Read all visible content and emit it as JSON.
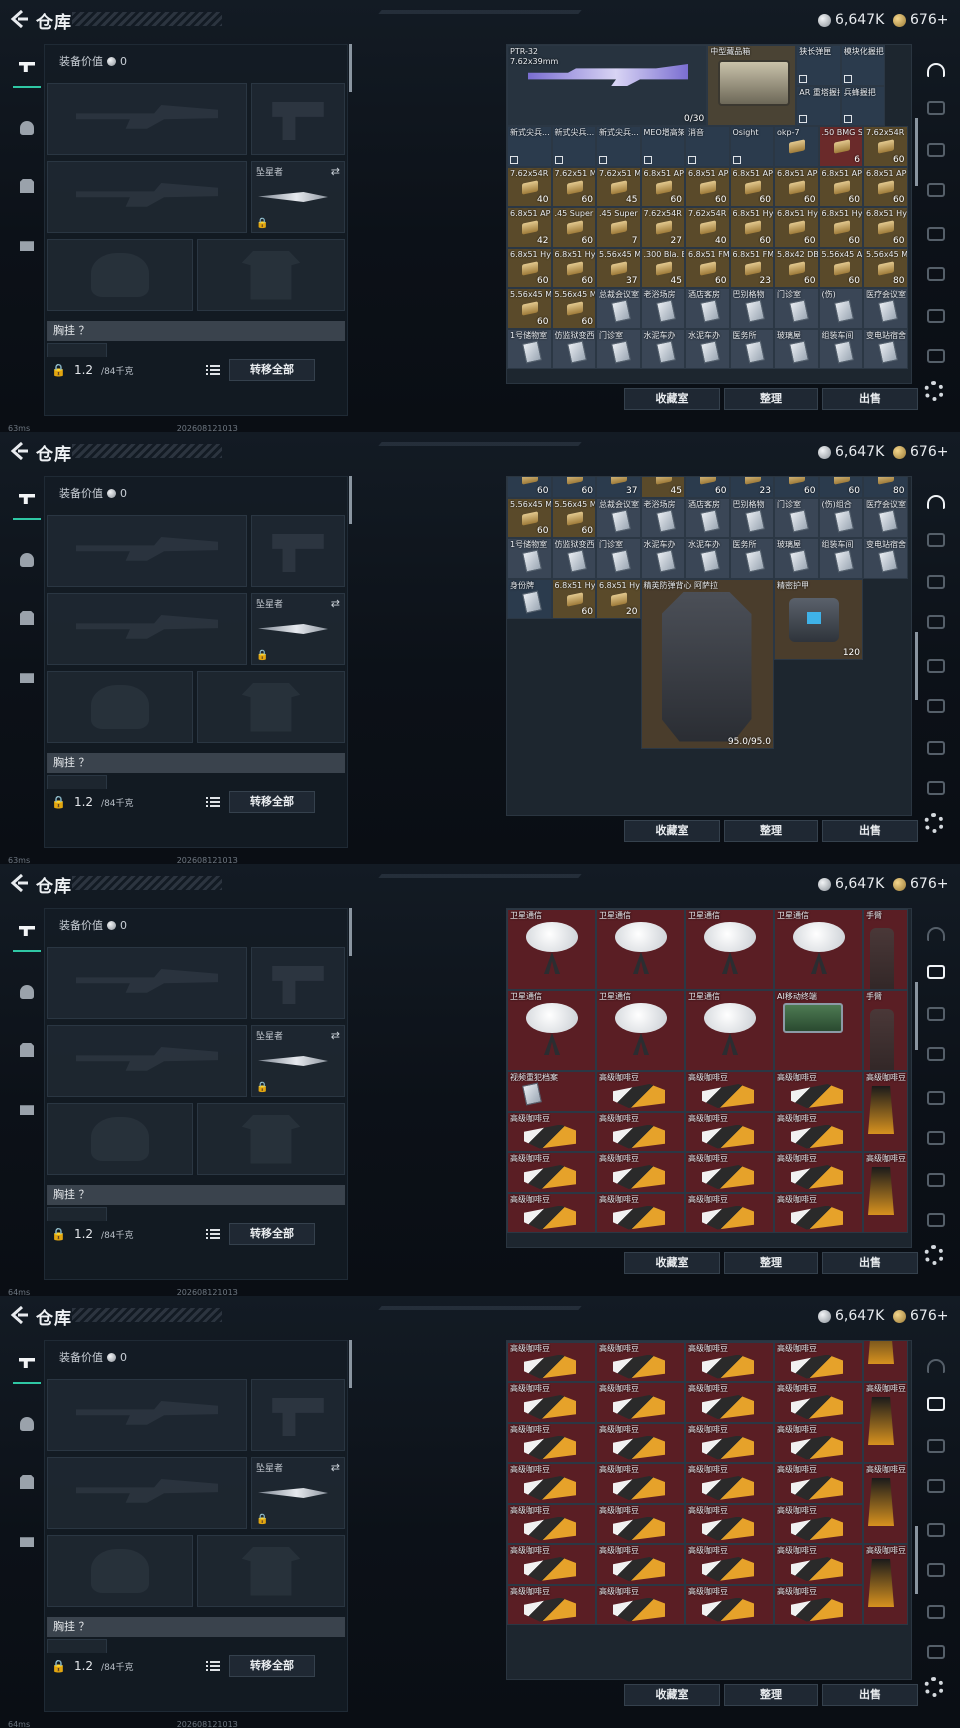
{
  "header": {
    "title": "仓库"
  },
  "currency": {
    "silver": "6,647K",
    "gold": "676+"
  },
  "gear": {
    "value_label": "装备价值",
    "value": "0",
    "knife_label": "坠星者",
    "chest_label": "胸挂 ？",
    "weight": "1.2",
    "capacity": "/84千克",
    "transfer_all": "转移全部"
  },
  "buttons": {
    "collect": "收藏室",
    "sort": "整理",
    "sell": "出售"
  },
  "status": {
    "frames": [
      {
        "ping": "63ms",
        "build": "_20260812101З"
      },
      {
        "ping": "63ms",
        "build": "_20260812101З"
      },
      {
        "ping": "64ms",
        "build": "_20260812101З"
      },
      {
        "ping": "64ms",
        "build": "_20260812101З"
      }
    ]
  },
  "grid1": {
    "rifle": {
      "name": "PTR-32",
      "caliber": "7.62x39mm",
      "count": "0/30"
    },
    "case": {
      "name": "中型藏品箱"
    },
    "small": [
      {
        "name": "狭长弹匣",
        "count": ""
      },
      {
        "name": "模块化握把",
        "count": ""
      },
      {
        "name": "AR 重塔握把",
        "count": ""
      },
      {
        "name": "兵蜂握把",
        "count": ""
      }
    ],
    "rows": [
      [
        {
          "n": "新式尖兵...",
          "c": ""
        },
        {
          "n": "新式尖兵...",
          "c": ""
        },
        {
          "n": "新式尖兵...",
          "c": ""
        },
        {
          "n": "MEO增高架",
          "c": ""
        },
        {
          "n": "消音",
          "c": ""
        },
        {
          "n": "Osight",
          "c": ""
        },
        {
          "n": "okp-7",
          "c": ""
        },
        {
          "n": ".50 BMG SLAP",
          "c": "6"
        },
        {
          "n": "7.62x54R SNB",
          "c": "60"
        }
      ],
      [
        {
          "n": "7.62x54R SNB",
          "c": "40"
        },
        {
          "n": "7.62x51 M62",
          "c": "60"
        },
        {
          "n": "7.62x51 M80",
          "c": "45"
        },
        {
          "n": "6.8x51 AP",
          "c": "60"
        },
        {
          "n": "6.8x51 AP",
          "c": "60"
        },
        {
          "n": "6.8x51 AP",
          "c": "60"
        },
        {
          "n": "6.8x51 AP",
          "c": "60"
        },
        {
          "n": "6.8x51 AP",
          "c": "60"
        },
        {
          "n": "6.8x51 AP",
          "c": "60"
        }
      ],
      [
        {
          "n": "6.8x51 AP",
          "c": "42"
        },
        {
          "n": ".45 Super",
          "c": "60"
        },
        {
          "n": ".45 Super",
          "c": "7"
        },
        {
          "n": "7.62x54R BT",
          "c": "27"
        },
        {
          "n": "7.62x54R BT",
          "c": "40"
        },
        {
          "n": "6.8x51 Hybrid",
          "c": "60"
        },
        {
          "n": "6.8x51 Hybrid",
          "c": "60"
        },
        {
          "n": "6.8x51 Hybrid",
          "c": "60"
        },
        {
          "n": "6.8x51 Hybrid",
          "c": "60"
        }
      ],
      [
        {
          "n": "6.8x51 Hybrid",
          "c": "60"
        },
        {
          "n": "6.8x51 Hybrid",
          "c": "60"
        },
        {
          "n": "5.56x45 M995",
          "c": "37"
        },
        {
          "n": ".300 Bla. BPZ",
          "c": "45"
        },
        {
          "n": "6.8x51 FMJ",
          "c": "60"
        },
        {
          "n": "6.8x51 FMJ",
          "c": "23"
        },
        {
          "n": "5.8x42 DBP10",
          "c": "60"
        },
        {
          "n": "5.56x45 AP",
          "c": "60"
        },
        {
          "n": "5.56x45 M855A1",
          "c": "80"
        }
      ],
      [
        {
          "n": "5.56x45 M855A1",
          "c": "60"
        },
        {
          "n": "5.56x45 M855A1",
          "c": "60"
        },
        {
          "n": "总裁会议室",
          "c": ""
        },
        {
          "n": "老浴场房",
          "c": ""
        },
        {
          "n": "酒店客房",
          "c": ""
        },
        {
          "n": "巴别格物",
          "c": ""
        },
        {
          "n": "门诊室",
          "c": ""
        },
        {
          "n": "(伤)",
          "c": ""
        },
        {
          "n": "医疗会议室",
          "c": ""
        }
      ],
      [
        {
          "n": "1号储物室",
          "c": ""
        },
        {
          "n": "仿监狱变西",
          "c": ""
        },
        {
          "n": "门诊室",
          "c": ""
        },
        {
          "n": "水泥车办",
          "c": ""
        },
        {
          "n": "水泥车办",
          "c": ""
        },
        {
          "n": "医务所",
          "c": ""
        },
        {
          "n": "玻璃屋",
          "c": ""
        },
        {
          "n": "组装车间",
          "c": ""
        },
        {
          "n": "变电站宿舍",
          "c": ""
        }
      ]
    ]
  },
  "grid2": {
    "rows": [
      [
        {
          "n": "6.8x51",
          "c": "60"
        },
        {
          "n": "6.8x51",
          "c": "60"
        },
        {
          "n": "5.56x45",
          "c": "37"
        },
        {
          "n": ".300 Bla.",
          "c": "45"
        },
        {
          "n": "6.8x51",
          "c": "60"
        },
        {
          "n": "6.8x51",
          "c": "23"
        },
        {
          "n": "5.8x42",
          "c": "60"
        },
        {
          "n": "5.56x45",
          "c": "60"
        },
        {
          "n": "5.56x45",
          "c": "80"
        }
      ],
      [
        {
          "n": "5.56x45 M855A1",
          "c": "60"
        },
        {
          "n": "5.56x45 M855A1",
          "c": "60"
        },
        {
          "n": "总裁会议室",
          "c": ""
        },
        {
          "n": "老浴场房",
          "c": ""
        },
        {
          "n": "酒店客房",
          "c": ""
        },
        {
          "n": "巴别格物",
          "c": ""
        },
        {
          "n": "门诊室",
          "c": ""
        },
        {
          "n": "(伤)组合",
          "c": ""
        },
        {
          "n": "医疗会议室",
          "c": ""
        }
      ],
      [
        {
          "n": "1号储物室",
          "c": ""
        },
        {
          "n": "仿监狱变西",
          "c": ""
        },
        {
          "n": "门诊室",
          "c": ""
        },
        {
          "n": "水泥车办",
          "c": ""
        },
        {
          "n": "水泥车办",
          "c": ""
        },
        {
          "n": "医务所",
          "c": ""
        },
        {
          "n": "玻璃屋",
          "c": ""
        },
        {
          "n": "组装车间",
          "c": ""
        },
        {
          "n": "变电站宿舍",
          "c": ""
        }
      ]
    ],
    "row4": [
      {
        "n": "身份牌",
        "c": ""
      },
      {
        "n": "6.8x51 Hybrid",
        "c": "60"
      },
      {
        "n": "6.8x51 Hybrid",
        "c": "20"
      }
    ],
    "vest": {
      "name": "精英防弹背心 阿萨拉",
      "durability": "95.0/95.0"
    },
    "bag": {
      "name": "精密护甲",
      "count": "120"
    }
  },
  "grid3": {
    "dish": "卫星通信",
    "hand": "手臂",
    "device": "AI移动终端",
    "document": "视频重犯档案",
    "coffee": "高级咖啡豆"
  },
  "colors": {
    "accent": "#2fc7a4",
    "red_cell": "#5a1e24",
    "gold_cell": "#5a4a2a",
    "blue_cell": "#2a3d52"
  }
}
